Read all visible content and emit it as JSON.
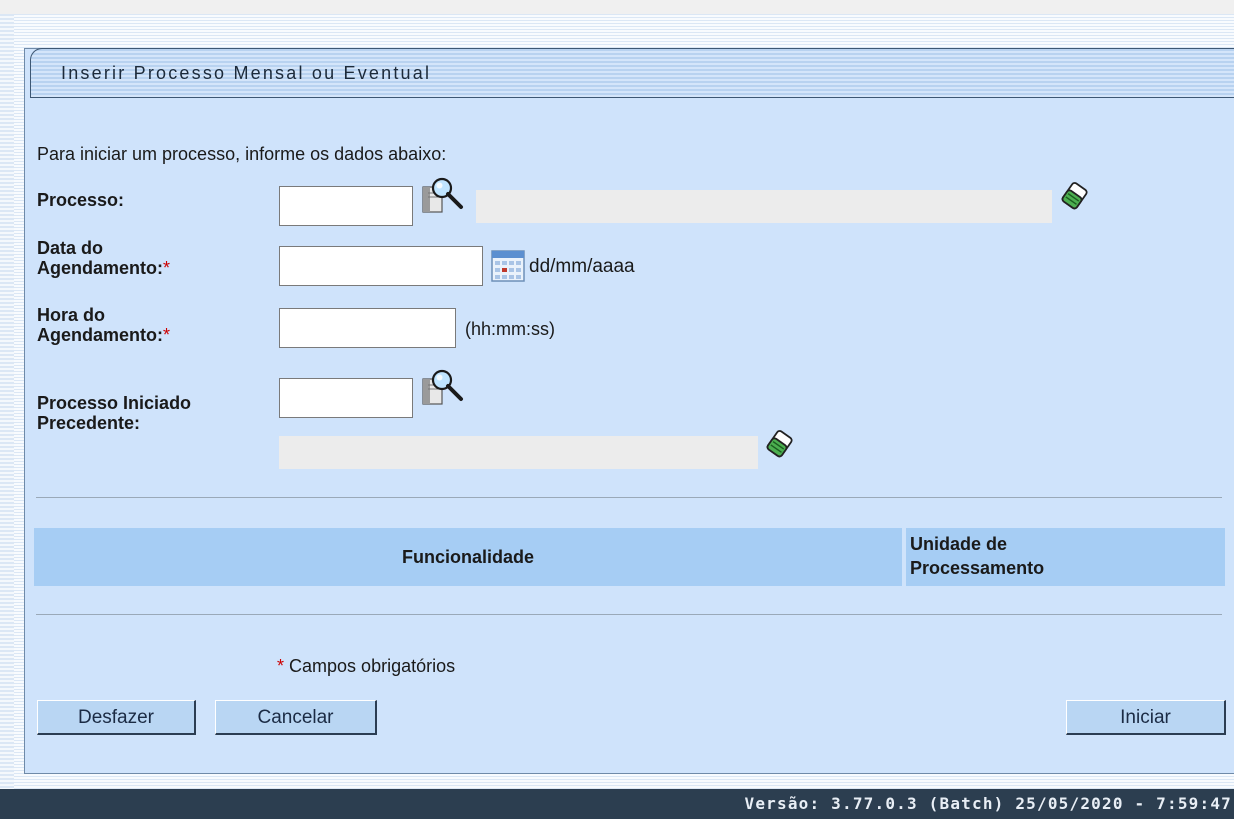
{
  "panel": {
    "title": "Inserir Processo Mensal ou Eventual"
  },
  "form": {
    "intro": "Para iniciar um processo, informe os dados abaixo:",
    "processo_label": "Processo:",
    "processo_value": "",
    "processo_descricao": "",
    "data_label_line1": "Data do",
    "data_label_line2": "Agendamento:",
    "data_value": "",
    "data_hint": "dd/mm/aaaa",
    "hora_label_line1": "Hora do",
    "hora_label_line2": "Agendamento:",
    "hora_value": "",
    "hora_hint": "(hh:mm:ss)",
    "precedente_label_line1": "Processo Iniciado",
    "precedente_label_line2": "Precedente:",
    "precedente_value": "",
    "precedente_descricao": "",
    "required_marker": "*"
  },
  "table": {
    "col_funcionalidade": "Funcionalidade",
    "col_unidade_line1": "Unidade de",
    "col_unidade_line2": "Processamento"
  },
  "required_note": {
    "marker": "*",
    "text": "Campos obrigatórios"
  },
  "buttons": {
    "desfazer": "Desfazer",
    "cancelar": "Cancelar",
    "iniciar": "Iniciar"
  },
  "footer": {
    "version": "Versão: 3.77.0.3 (Batch) 25/05/2020 - 7:59:47"
  },
  "icons": [
    "search-icon",
    "calendar-icon",
    "eraser-icon"
  ],
  "colors": {
    "panel_bg": "#cfe3fb",
    "table_header_bg": "#a6cdf4",
    "button_bg": "#b9d6f3",
    "footer_bg": "#2c3e50",
    "required": "#cc0000"
  }
}
